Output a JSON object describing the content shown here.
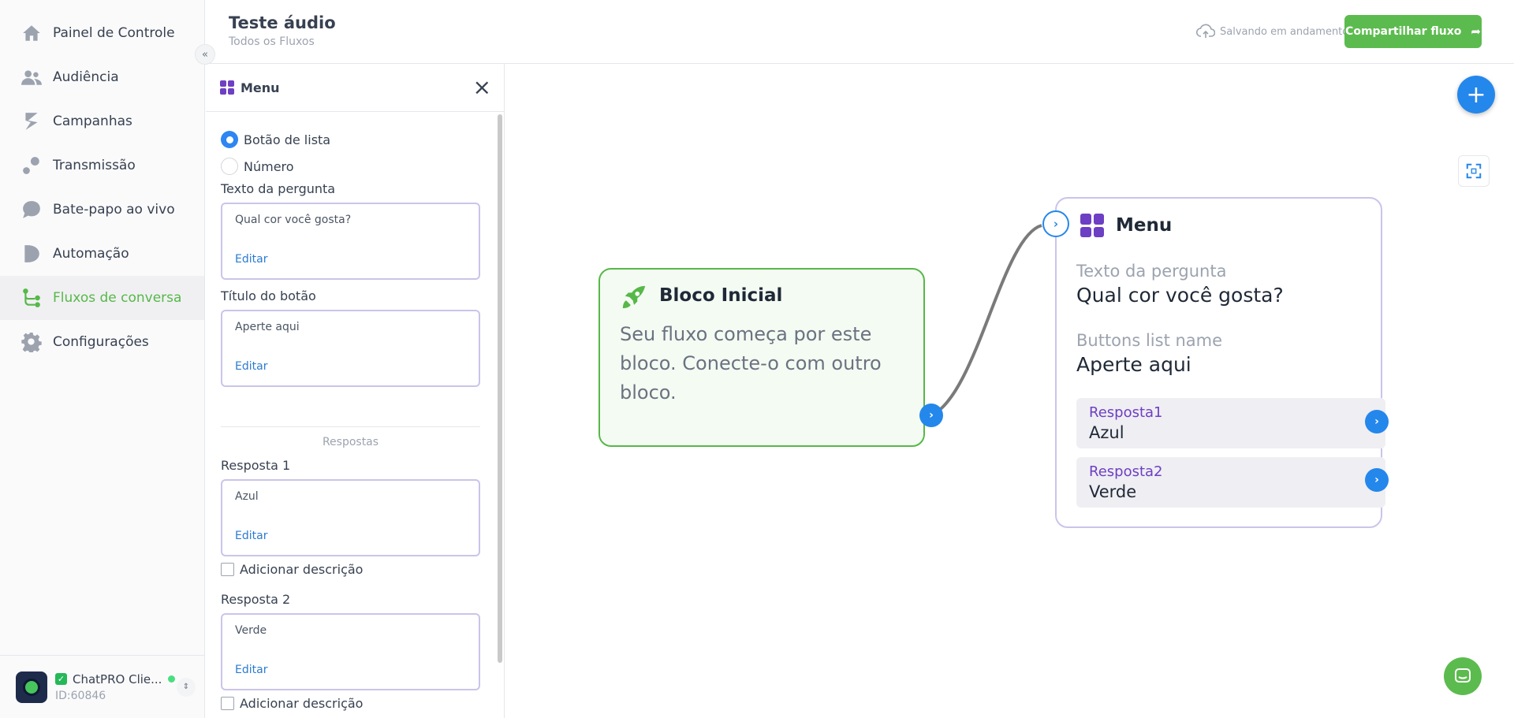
{
  "sidebar": {
    "items": [
      {
        "label": "Painel de Controle",
        "icon": "home-icon"
      },
      {
        "label": "Audiência",
        "icon": "users-icon"
      },
      {
        "label": "Campanhas",
        "icon": "campaign-icon"
      },
      {
        "label": "Transmissão",
        "icon": "broadcast-icon"
      },
      {
        "label": "Bate-papo ao vivo",
        "icon": "chat-icon"
      },
      {
        "label": "Automação",
        "icon": "automation-icon"
      },
      {
        "label": "Fluxos de conversa",
        "icon": "flow-icon",
        "active": true
      },
      {
        "label": "Configurações",
        "icon": "gear-icon"
      }
    ],
    "collapse_glyph": "«",
    "account": {
      "name": "ChatPRO Clie...",
      "id": "ID:60846"
    }
  },
  "header": {
    "title": "Teste áudio",
    "subtitle": "Todos os Fluxos",
    "saving_text": "Salvando em andamento",
    "share_label": "Compartilhar fluxo"
  },
  "panel": {
    "title": "Menu",
    "radio_options": [
      {
        "label": "Botão de lista",
        "selected": true
      },
      {
        "label": "Número",
        "selected": false
      }
    ],
    "question_label": "Texto da pergunta",
    "question_value": "Qual cor você gosta?",
    "button_title_label": "Título do botão",
    "button_title_value": "Aperte aqui",
    "edit_label": "Editar",
    "responses_section": "Respostas",
    "responses": [
      {
        "label": "Resposta 1",
        "value": "Azul"
      },
      {
        "label": "Resposta 2",
        "value": "Verde"
      }
    ],
    "add_description_label": "Adicionar descrição"
  },
  "canvas": {
    "start_node": {
      "title": "Bloco Inicial",
      "description": "Seu fluxo começa por este bloco. Conecte-o com outro bloco."
    },
    "menu_node": {
      "title": "Menu",
      "question_label": "Texto da pergunta",
      "question_value": "Qual cor você gosta?",
      "buttons_label": "Buttons list name",
      "buttons_value": "Aperte aqui",
      "responses": [
        {
          "label": "Resposta1",
          "value": "Azul"
        },
        {
          "label": "Resposta2",
          "value": "Verde"
        }
      ]
    }
  },
  "colors": {
    "brand_green": "#5cbb4e",
    "accent_blue": "#2487eb",
    "menu_purple": "#6d3fc4"
  }
}
